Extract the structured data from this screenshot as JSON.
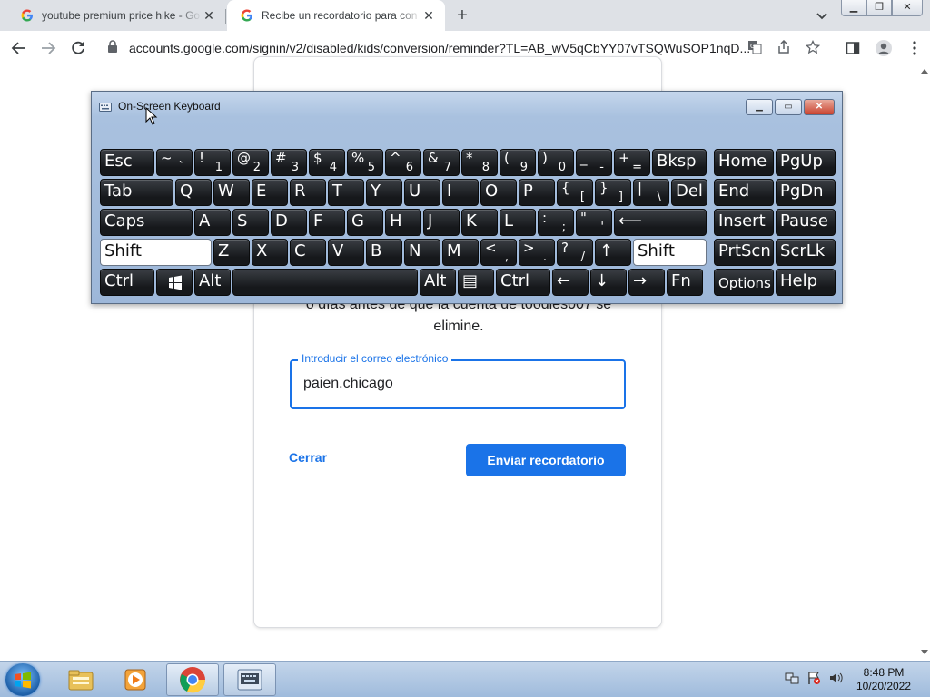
{
  "browser": {
    "tabs": [
      {
        "title": "youtube premium price hike - Go",
        "active": false
      },
      {
        "title": "Recibe un recordatorio para con",
        "active": true
      }
    ],
    "new_tab_label": "+",
    "url": "accounts.google.com/signin/v2/disabled/kids/conversion/reminder?TL=AB_wV5qCbYY07vTSQWuSOP1nqD..."
  },
  "page": {
    "body_text_line1": "o días antes de que la cuenta de toodles007 se",
    "body_text_line2": "elimine.",
    "email_field": {
      "label": "Introducir el correo electrónico",
      "value": "paien.chicago"
    },
    "cancel_label": "Cerrar",
    "submit_label": "Enviar recordatorio"
  },
  "osk": {
    "title": "On-Screen Keyboard",
    "rows": [
      [
        {
          "label": "Esc"
        },
        {
          "sup": "~",
          "sub": "`"
        },
        {
          "sup": "!",
          "sub": "1"
        },
        {
          "sup": "@",
          "sub": "2"
        },
        {
          "sup": "#",
          "sub": "3"
        },
        {
          "sup": "$",
          "sub": "4"
        },
        {
          "sup": "%",
          "sub": "5"
        },
        {
          "sup": "^",
          "sub": "6"
        },
        {
          "sup": "&",
          "sub": "7"
        },
        {
          "sup": "*",
          "sub": "8"
        },
        {
          "sup": "(",
          "sub": "9"
        },
        {
          "sup": ")",
          "sub": "0"
        },
        {
          "sup": "_",
          "sub": "-"
        },
        {
          "sup": "+",
          "sub": "="
        },
        {
          "label": "Bksp"
        },
        {
          "label": "Home"
        },
        {
          "label": "PgUp"
        }
      ],
      [
        {
          "label": "Tab"
        },
        {
          "label": "Q"
        },
        {
          "label": "W"
        },
        {
          "label": "E"
        },
        {
          "label": "R"
        },
        {
          "label": "T"
        },
        {
          "label": "Y"
        },
        {
          "label": "U"
        },
        {
          "label": "I"
        },
        {
          "label": "O"
        },
        {
          "label": "P"
        },
        {
          "sup": "{",
          "sub": "["
        },
        {
          "sup": "}",
          "sub": "]"
        },
        {
          "sup": "|",
          "sub": "\\"
        },
        {
          "label": "Del"
        },
        {
          "label": "End"
        },
        {
          "label": "PgDn"
        }
      ],
      [
        {
          "label": "Caps"
        },
        {
          "label": "A"
        },
        {
          "label": "S"
        },
        {
          "label": "D"
        },
        {
          "label": "F"
        },
        {
          "label": "G"
        },
        {
          "label": "H"
        },
        {
          "label": "J"
        },
        {
          "label": "K"
        },
        {
          "label": "L"
        },
        {
          "sup": ":",
          "sub": ";"
        },
        {
          "sup": "\"",
          "sub": "'"
        },
        {
          "label": "⟵"
        },
        {
          "label": "Insert"
        },
        {
          "label": "Pause"
        }
      ],
      [
        {
          "label": "Shift"
        },
        {
          "label": "Z"
        },
        {
          "label": "X"
        },
        {
          "label": "C"
        },
        {
          "label": "V"
        },
        {
          "label": "B"
        },
        {
          "label": "N"
        },
        {
          "label": "M"
        },
        {
          "sup": "<",
          "sub": ","
        },
        {
          "sup": ">",
          "sub": "."
        },
        {
          "sup": "?",
          "sub": "/"
        },
        {
          "label": "↑"
        },
        {
          "label": "Shift"
        },
        {
          "label": "PrtScn"
        },
        {
          "label": "ScrLk"
        }
      ],
      [
        {
          "label": "Ctrl"
        },
        {
          "label": ""
        },
        {
          "label": "Alt"
        },
        {
          "label": ""
        },
        {
          "label": "Alt"
        },
        {
          "label": "▤"
        },
        {
          "label": "Ctrl"
        },
        {
          "label": "←"
        },
        {
          "label": "↓"
        },
        {
          "label": "→"
        },
        {
          "label": "Fn"
        },
        {
          "label": "Options"
        },
        {
          "label": "Help"
        }
      ]
    ]
  },
  "taskbar": {
    "time": "8:48 PM",
    "date": "10/20/2022"
  },
  "colors": {
    "accent": "#1a73e8",
    "key": "#1f2226",
    "osk_frame": "#a9c1df"
  }
}
